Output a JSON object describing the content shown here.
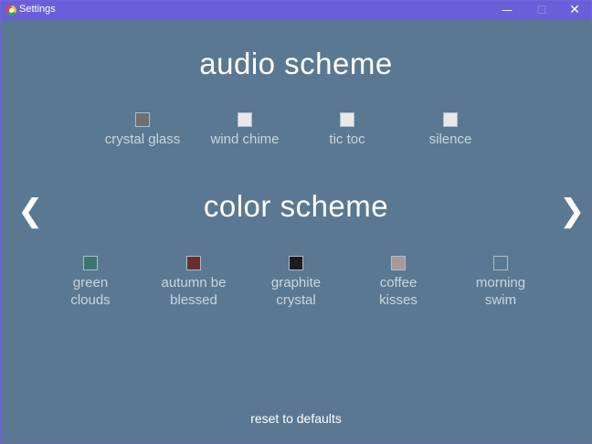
{
  "window": {
    "title": "Settings",
    "minimize_glyph": "—",
    "maximize_glyph": "☐",
    "close_glyph": "✕"
  },
  "audio": {
    "heading": "audio scheme",
    "options": [
      {
        "label": "crystal glass",
        "color": "#6e6e6e"
      },
      {
        "label": "wind chime",
        "color": "#e8e8e8"
      },
      {
        "label": "tic toc",
        "color": "#e8e8e8"
      },
      {
        "label": "silence",
        "color": "#e8e8e8"
      }
    ]
  },
  "color": {
    "heading": "color scheme",
    "options": [
      {
        "label_line1": "green",
        "label_line2": "clouds",
        "color": "#3b7570"
      },
      {
        "label_line1": "autumn be",
        "label_line2": "blessed",
        "color": "#6b2e2e"
      },
      {
        "label_line1": "graphite",
        "label_line2": "crystal",
        "color": "#1c1c1c"
      },
      {
        "label_line1": "coffee",
        "label_line2": "kisses",
        "color": "#a69898"
      },
      {
        "label_line1": "morning",
        "label_line2": "swim",
        "color": "#5a7891"
      }
    ]
  },
  "nav": {
    "prev_glyph": "❮",
    "next_glyph": "❯"
  },
  "footer": {
    "reset_label": "reset to defaults"
  }
}
